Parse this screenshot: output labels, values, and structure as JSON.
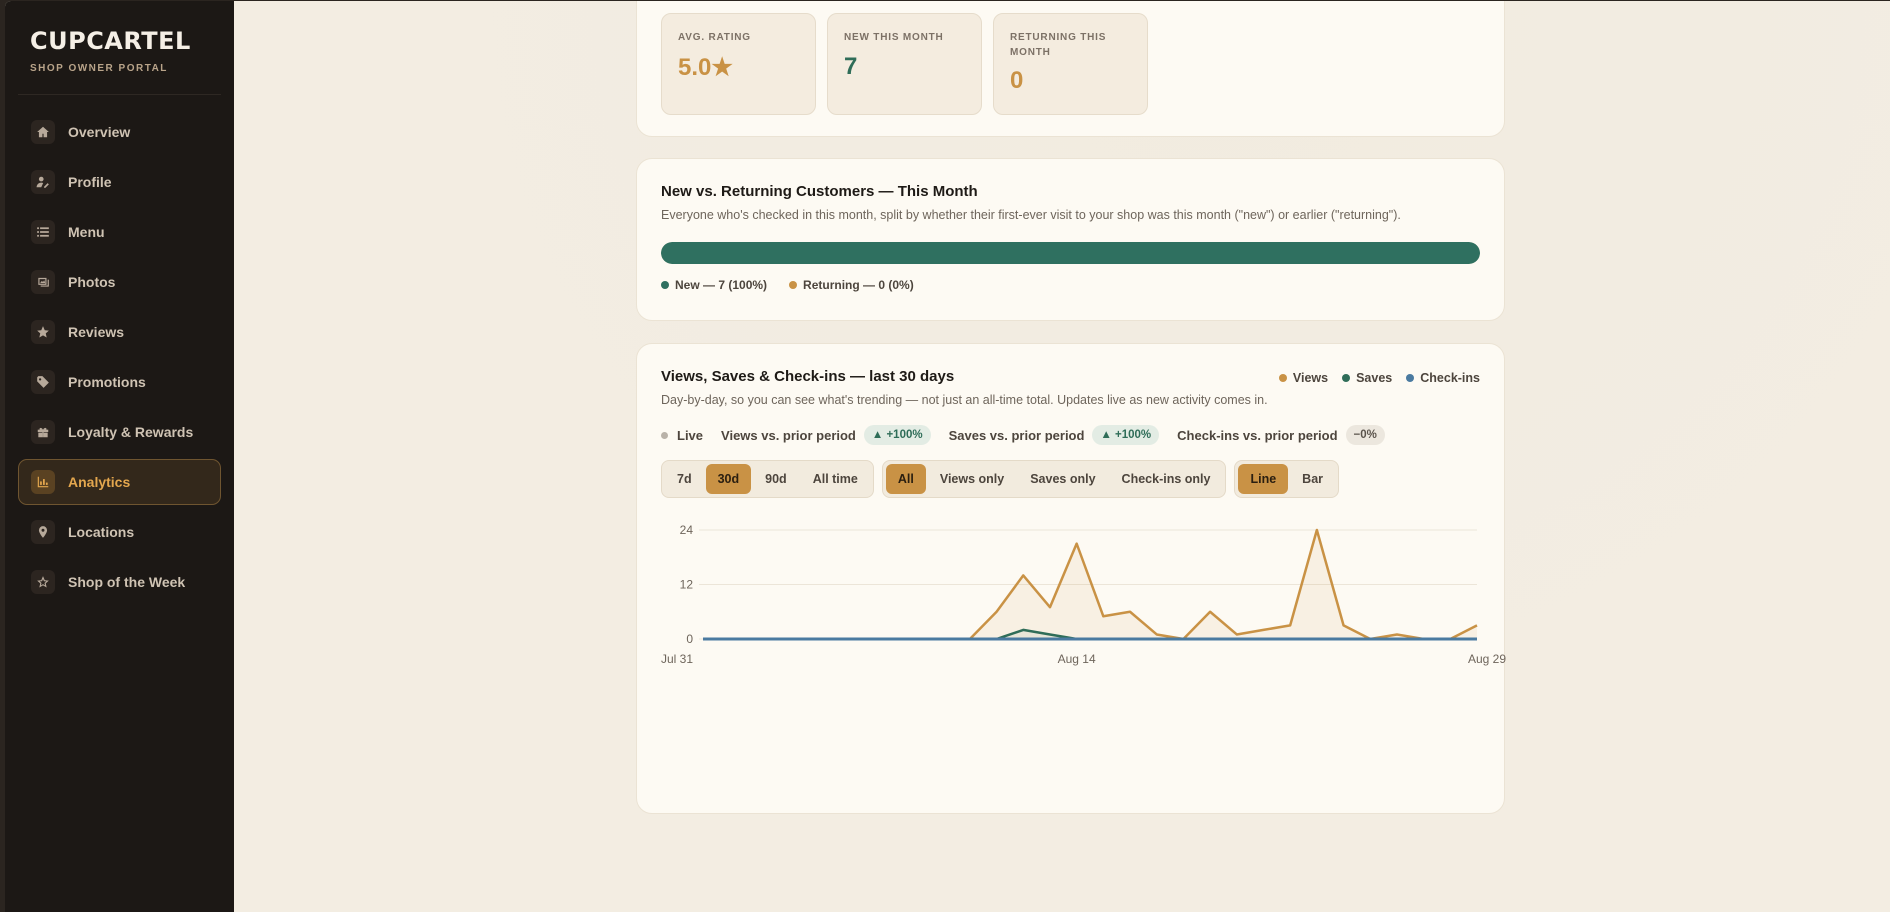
{
  "brand": {
    "logo": "CUPCARTEL",
    "subtitle": "SHOP OWNER PORTAL"
  },
  "nav": [
    {
      "label": "Overview",
      "icon": "home-icon",
      "active": false
    },
    {
      "label": "Profile",
      "icon": "profile-edit-icon",
      "active": false
    },
    {
      "label": "Menu",
      "icon": "list-icon",
      "active": false
    },
    {
      "label": "Photos",
      "icon": "photos-icon",
      "active": false
    },
    {
      "label": "Reviews",
      "icon": "star-icon",
      "active": false
    },
    {
      "label": "Promotions",
      "icon": "tag-icon",
      "active": false
    },
    {
      "label": "Loyalty & Rewards",
      "icon": "gift-icon",
      "active": false
    },
    {
      "label": "Analytics",
      "icon": "bar-chart-icon",
      "active": true
    },
    {
      "label": "Locations",
      "icon": "map-pin-icon",
      "active": false
    },
    {
      "label": "Shop of the Week",
      "icon": "award-star-icon",
      "active": false
    }
  ],
  "stats": [
    {
      "label": "AVG. RATING",
      "value": "5.0★",
      "color": "#c99245"
    },
    {
      "label": "NEW THIS MONTH",
      "value": "7",
      "color": "#2f6d58"
    },
    {
      "label": "RETURNING THIS MONTH",
      "value": "0",
      "color": "#c99245"
    }
  ],
  "new_vs_returning": {
    "title": "New vs. Returning Customers — This Month",
    "description": "Everyone who's checked in this month, split by whether their first-ever visit to your shop was this month (\"new\") or earlier (\"returning\").",
    "new_fraction": 1.0,
    "legend_new": "New — 7 (100%)",
    "legend_returning": "Returning — 0 (0%)"
  },
  "activity": {
    "title": "Views, Saves & Check-ins — last 30 days",
    "description": "Day-by-day, so you can see what's trending — not just an all-time total. Updates live as new activity comes in.",
    "live_label": "Live",
    "trends": [
      {
        "label": "Views vs. prior period",
        "value": "▲ +100%",
        "kind": "up"
      },
      {
        "label": "Saves vs. prior period",
        "value": "▲ +100%",
        "kind": "up"
      },
      {
        "label": "Check-ins vs. prior period",
        "value": "−0%",
        "kind": "flat"
      }
    ],
    "range_options": [
      "7d",
      "30d",
      "90d",
      "All time"
    ],
    "range_selected": "30d",
    "metric_options": [
      "All",
      "Views only",
      "Saves only",
      "Check-ins only"
    ],
    "metric_selected": "All",
    "style_options": [
      "Line",
      "Bar"
    ],
    "style_selected": "Line"
  },
  "colors": {
    "views": "#c99245",
    "saves": "#2f6d58",
    "checkins": "#4a7aa0"
  },
  "chart_data": {
    "type": "line",
    "title": "",
    "x": [
      "Jul 31",
      "Aug 1",
      "Aug 2",
      "Aug 3",
      "Aug 4",
      "Aug 5",
      "Aug 6",
      "Aug 7",
      "Aug 8",
      "Aug 9",
      "Aug 10",
      "Aug 11",
      "Aug 12",
      "Aug 13",
      "Aug 14",
      "Aug 15",
      "Aug 16",
      "Aug 17",
      "Aug 18",
      "Aug 19",
      "Aug 20",
      "Aug 21",
      "Aug 22",
      "Aug 23",
      "Aug 24",
      "Aug 25",
      "Aug 26",
      "Aug 27",
      "Aug 28",
      "Aug 29"
    ],
    "x_tick_labels": [
      "Jul 31",
      "Aug 14",
      "Aug 29"
    ],
    "y_ticks": [
      0,
      12,
      24
    ],
    "ylim": [
      0,
      24
    ],
    "series": [
      {
        "name": "Views",
        "values": [
          0,
          0,
          0,
          0,
          0,
          0,
          0,
          0,
          0,
          0,
          0,
          6,
          14,
          7,
          21,
          5,
          6,
          1,
          0,
          6,
          1,
          2,
          3,
          24,
          3,
          0,
          1,
          0,
          0,
          3
        ]
      },
      {
        "name": "Saves",
        "values": [
          0,
          0,
          0,
          0,
          0,
          0,
          0,
          0,
          0,
          0,
          0,
          0,
          2,
          1,
          0,
          0,
          0,
          0,
          0,
          0,
          0,
          0,
          0,
          0,
          0,
          0,
          0,
          0,
          0,
          0
        ]
      },
      {
        "name": "Check-ins",
        "values": [
          0,
          0,
          0,
          0,
          0,
          0,
          0,
          0,
          0,
          0,
          0,
          0,
          0,
          0,
          0,
          0,
          0,
          0,
          0,
          0,
          0,
          0,
          0,
          0,
          0,
          0,
          0,
          0,
          0,
          0
        ]
      }
    ],
    "grid": true,
    "legend": "top-right"
  }
}
